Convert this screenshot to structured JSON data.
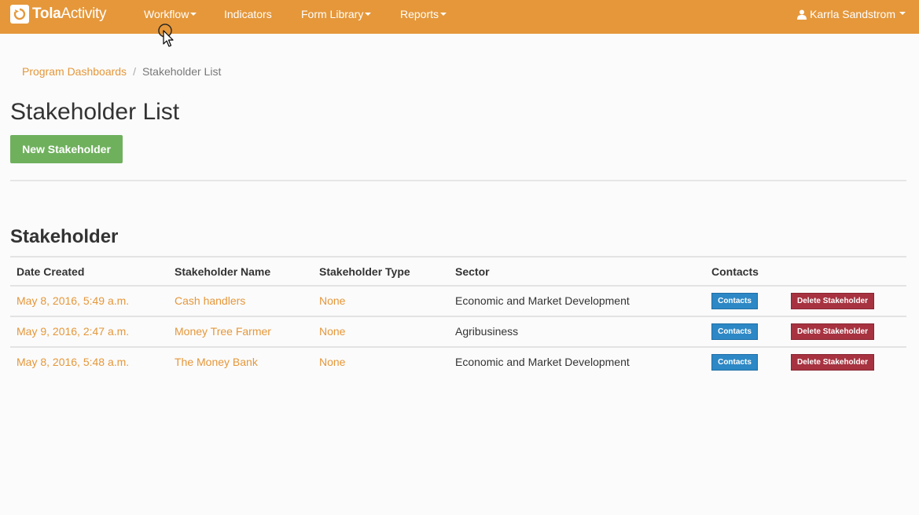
{
  "brand": {
    "bold": "Tola",
    "light": "Activity"
  },
  "nav": {
    "workflow": "Workflow",
    "indicators": "Indicators",
    "form_library": "Form Library",
    "reports": "Reports",
    "user": "Karrla Sandstrom"
  },
  "breadcrumb": {
    "link": "Program Dashboards",
    "separator": "/",
    "current": "Stakeholder List"
  },
  "page": {
    "title": "Stakeholder List",
    "new_button": "New Stakeholder",
    "section_title": "Stakeholder"
  },
  "table": {
    "headers": [
      "Date Created",
      "Stakeholder Name",
      "Stakeholder Type",
      "Sector",
      "Contacts"
    ],
    "rows": [
      {
        "date": "May 8, 2016, 5:49 a.m.",
        "name": "Cash handlers",
        "type": "None",
        "sector": "Economic and Market Development",
        "contacts": "Contacts",
        "delete": "Delete Stakeholder"
      },
      {
        "date": "May 9, 2016, 2:47 a.m.",
        "name": "Money Tree Farmer",
        "type": "None",
        "sector": "Agribusiness",
        "contacts": "Contacts",
        "delete": "Delete Stakeholder"
      },
      {
        "date": "May 8, 2016, 5:48 a.m.",
        "name": "The Money Bank",
        "type": "None",
        "sector": "Economic and Market Development",
        "contacts": "Contacts",
        "delete": "Delete Stakeholder"
      }
    ]
  },
  "colors": {
    "navbar": "#e5973a",
    "link": "#e5973a",
    "new_button": "#6fb05d",
    "contacts_button": "#2d88c5",
    "delete_button": "#a73240"
  },
  "icons": {
    "logo": "tola-logo-icon",
    "user": "user-icon",
    "caret": "caret-down-icon",
    "cursor": "mouse-cursor-icon"
  }
}
